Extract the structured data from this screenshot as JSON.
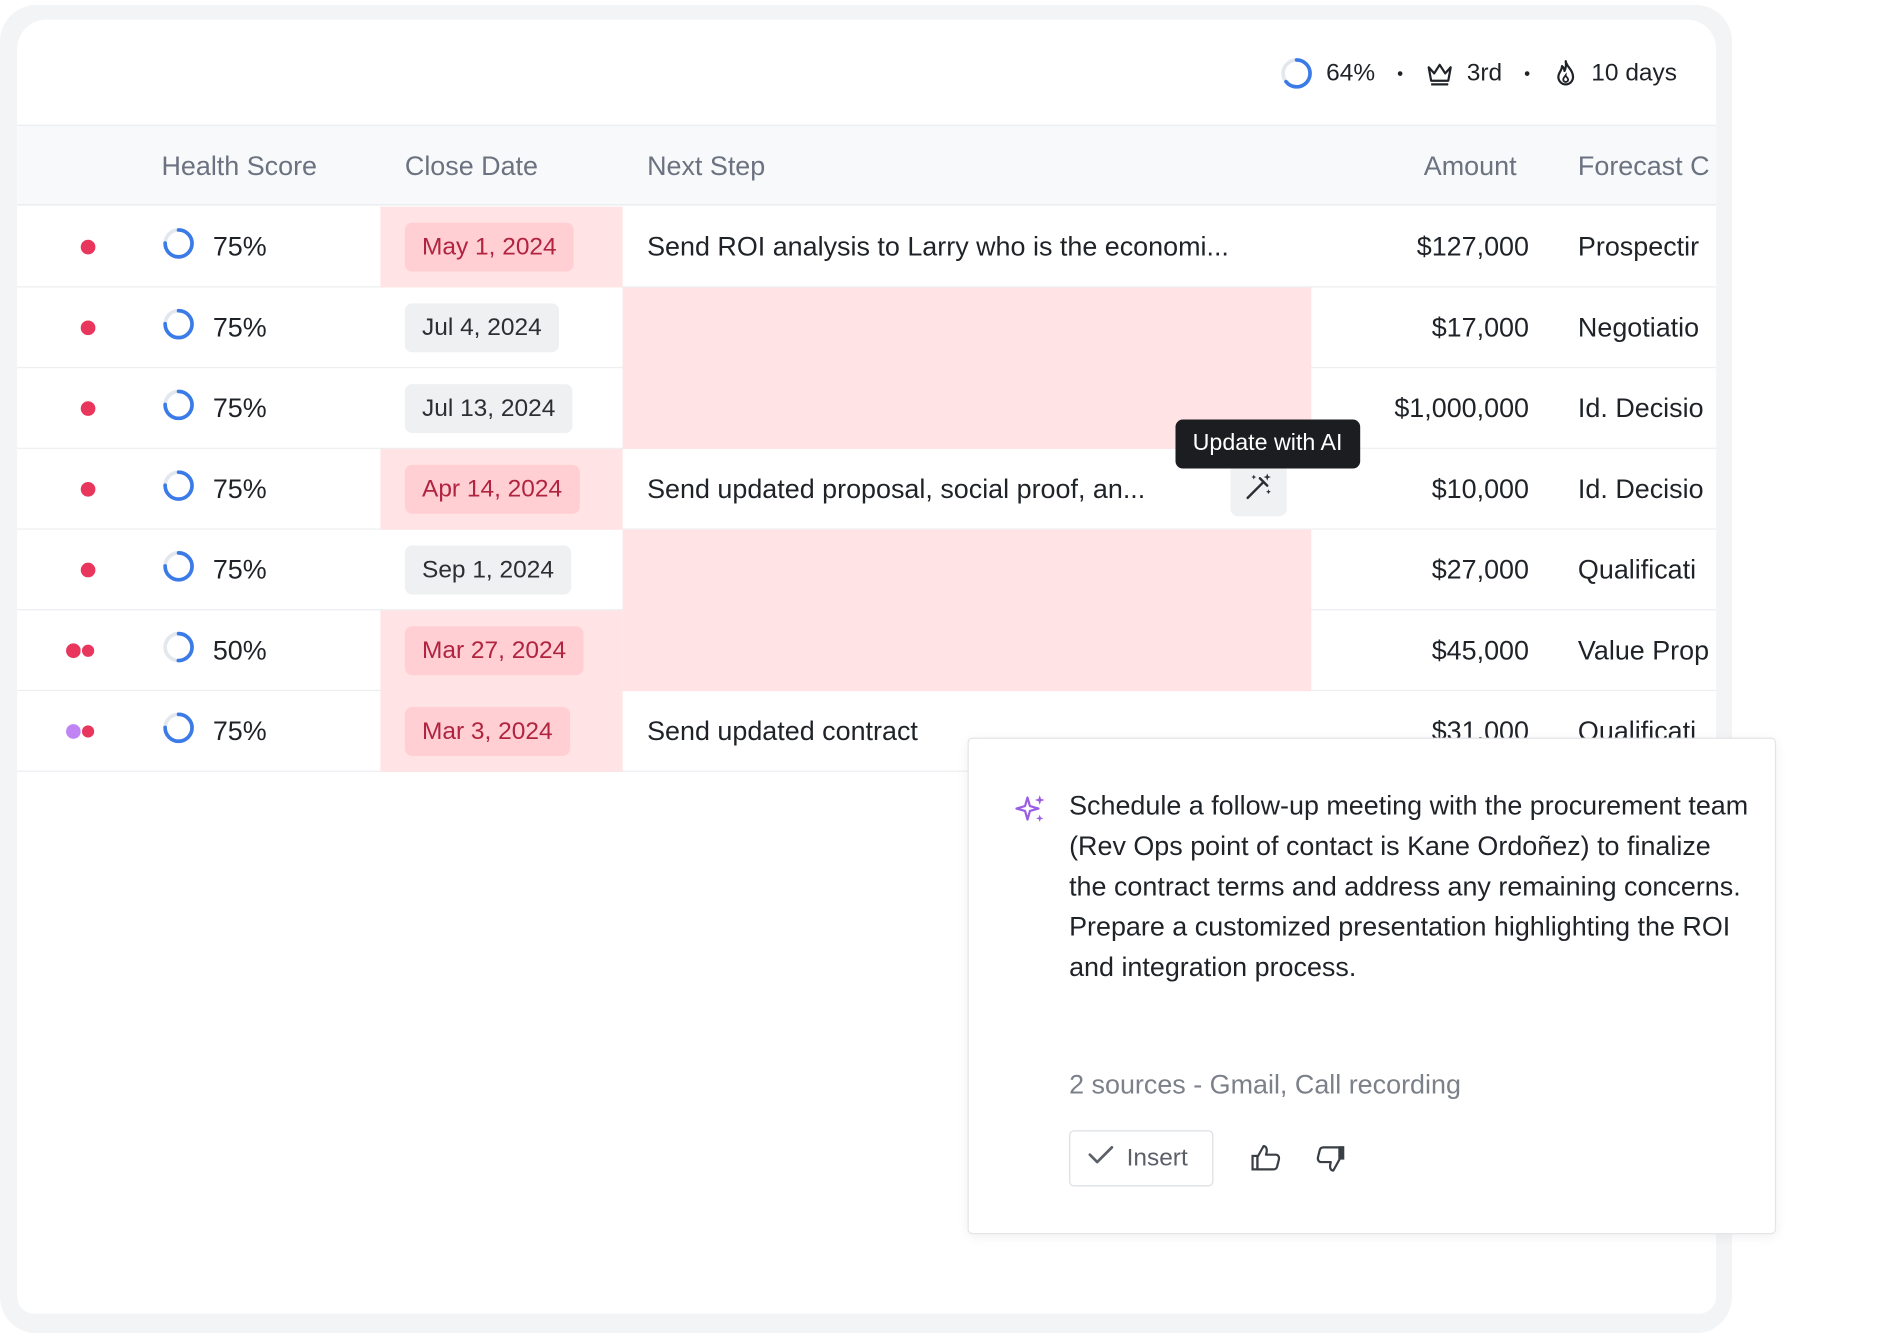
{
  "stats": {
    "progress": "64%",
    "progress_value": 0.64,
    "rank": "3rd",
    "streak": "10 days",
    "separator": "•"
  },
  "columns": {
    "health": "Health Score",
    "close_date": "Close Date",
    "next_step": "Next Step",
    "amount": "Amount",
    "forecast": "Forecast C"
  },
  "rows": [
    {
      "dot": "red",
      "health": "75%",
      "health_value": 0.75,
      "close_date": "May 1, 2024",
      "date_style": "red",
      "next_step": "Send ROI analysis to Larry who is the economi...",
      "amount": "$127,000",
      "forecast": "Prospectir"
    },
    {
      "dot": "red",
      "health": "75%",
      "health_value": 0.75,
      "close_date": "Jul 4, 2024",
      "date_style": "gray",
      "next_step": "",
      "amount": "$17,000",
      "forecast": "Negotiatio"
    },
    {
      "dot": "red",
      "health": "75%",
      "health_value": 0.75,
      "close_date": "Jul 13, 2024",
      "date_style": "gray",
      "next_step": "",
      "amount": "$1,000,000",
      "forecast": "Id. Decisio"
    },
    {
      "dot": "red",
      "health": "75%",
      "health_value": 0.75,
      "close_date": "Apr 14, 2024",
      "date_style": "red",
      "next_step": "Send updated proposal, social proof, an...",
      "amount": "$10,000",
      "forecast": "Id. Decisio"
    },
    {
      "dot": "red",
      "health": "75%",
      "health_value": 0.75,
      "close_date": "Sep 1, 2024",
      "date_style": "gray",
      "next_step": "",
      "amount": "$27,000",
      "forecast": "Qualificati"
    },
    {
      "dot": "red-pair",
      "health": "50%",
      "health_value": 0.5,
      "close_date": "Mar 27, 2024",
      "date_style": "red",
      "next_step": "",
      "amount": "$45,000",
      "forecast": "Value Prop"
    },
    {
      "dot": "purple-pair",
      "health": "75%",
      "health_value": 0.75,
      "close_date": "Mar 3, 2024",
      "date_style": "red",
      "next_step": "Send updated contract",
      "amount": "$31,000",
      "forecast": "Qualificati"
    }
  ],
  "tooltip": "Update with AI",
  "suggestion": {
    "text": "Schedule a follow-up meeting with the procurement team (Rev Ops point of contact is Kane Ordoñez) to finalize the contract terms and address any remaining concerns. Prepare a customized presentation highlighting the ROI and integration process.",
    "sources": "2 sources - Gmail, Call recording",
    "insert_label": "Insert"
  },
  "colors": {
    "accent_blue": "#3b7be8",
    "alert_red": "#e8365d",
    "highlight_pink": "#ffe3e5",
    "chip_red": "#ffcfd4",
    "purple": "#c084f5",
    "sparkle_purple": "#9b5de5"
  },
  "icons": {
    "progress": "progress-ring-icon",
    "rank": "crown-icon",
    "streak": "flame-icon",
    "update": "magic-wand-icon",
    "sparkle": "sparkle-icon",
    "check": "check-icon",
    "like": "thumbs-up-icon",
    "dislike": "thumbs-down-icon"
  }
}
